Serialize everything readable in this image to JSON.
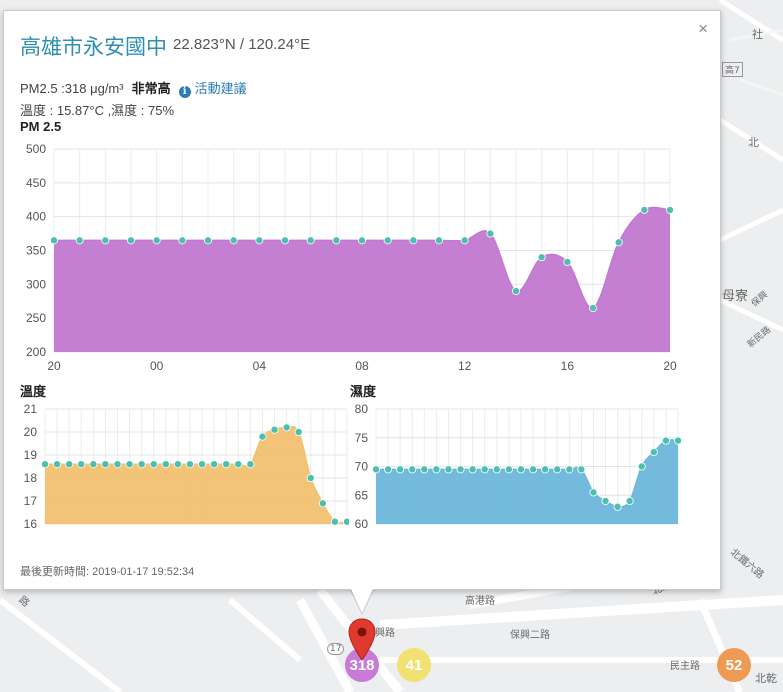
{
  "map": {
    "labels": [
      "社",
      "高7",
      "北",
      "母寮",
      "保興",
      "新民路",
      "北鐵六路",
      "北鐵二路",
      "路",
      "保興二路",
      "保興路",
      "民主路",
      "北乾",
      "17",
      "高港路"
    ],
    "clusters": [
      {
        "label": "318",
        "color": "#c77bd6"
      },
      {
        "label": "41",
        "color": "#f0e170"
      },
      {
        "label": "52",
        "color": "#ef9a52"
      }
    ]
  },
  "popup": {
    "title": "高雄市永安國中",
    "coords": "22.823°N / 120.24°E",
    "close": "×",
    "pm_text": "PM2.5 :318 μg/m³",
    "level": "非常高",
    "info_icon": "i",
    "advice_link": "活動建議",
    "weather": "溫度 : 15.87°C ,濕度 : 75%",
    "updated": "最後更新時間: 2019-01-17 19:52:34"
  },
  "chart_data": [
    {
      "type": "area",
      "title": "PM 2.5",
      "color": "#c178d1",
      "x_ticks": [
        "20",
        "00",
        "04",
        "08",
        "12",
        "16",
        "20"
      ],
      "ylim": [
        200,
        500
      ],
      "y_ticks": [
        200,
        250,
        300,
        350,
        400,
        450,
        500
      ],
      "x": [
        0,
        1,
        2,
        3,
        4,
        5,
        6,
        7,
        8,
        9,
        10,
        11,
        12,
        13,
        14,
        15,
        16,
        17,
        18,
        19,
        20,
        21,
        22,
        23,
        24
      ],
      "values": [
        365,
        365,
        365,
        365,
        365,
        365,
        365,
        365,
        365,
        365,
        365,
        365,
        365,
        365,
        365,
        365,
        365,
        375,
        290,
        340,
        333,
        265,
        362,
        410,
        410
      ],
      "grid": true
    },
    {
      "type": "area",
      "title": "溫度",
      "color": "#f2c071",
      "ylim": [
        16,
        21
      ],
      "y_ticks": [
        16,
        17,
        18,
        19,
        20,
        21
      ],
      "x": [
        0,
        1,
        2,
        3,
        4,
        5,
        6,
        7,
        8,
        9,
        10,
        11,
        12,
        13,
        14,
        15,
        16,
        17,
        18,
        19,
        20,
        21,
        22,
        23,
        24,
        25
      ],
      "values": [
        18.6,
        18.6,
        18.6,
        18.6,
        18.6,
        18.6,
        18.6,
        18.6,
        18.6,
        18.6,
        18.6,
        18.6,
        18.6,
        18.6,
        18.6,
        18.6,
        18.6,
        18.6,
        19.8,
        20.1,
        20.2,
        20.0,
        18.0,
        16.9,
        16.1,
        16.1
      ],
      "grid": true
    },
    {
      "type": "area",
      "title": "濕度",
      "color": "#6bb6da",
      "ylim": [
        60,
        80
      ],
      "y_ticks": [
        60,
        65,
        70,
        75,
        80
      ],
      "x": [
        0,
        1,
        2,
        3,
        4,
        5,
        6,
        7,
        8,
        9,
        10,
        11,
        12,
        13,
        14,
        15,
        16,
        17,
        18,
        19,
        20,
        21,
        22,
        23,
        24,
        25
      ],
      "values": [
        69.5,
        69.5,
        69.5,
        69.5,
        69.5,
        69.5,
        69.5,
        69.5,
        69.5,
        69.5,
        69.5,
        69.5,
        69.5,
        69.5,
        69.5,
        69.5,
        69.5,
        69.5,
        65.5,
        64,
        63,
        64,
        70,
        72.5,
        74.5,
        74.5
      ],
      "grid": true
    }
  ]
}
